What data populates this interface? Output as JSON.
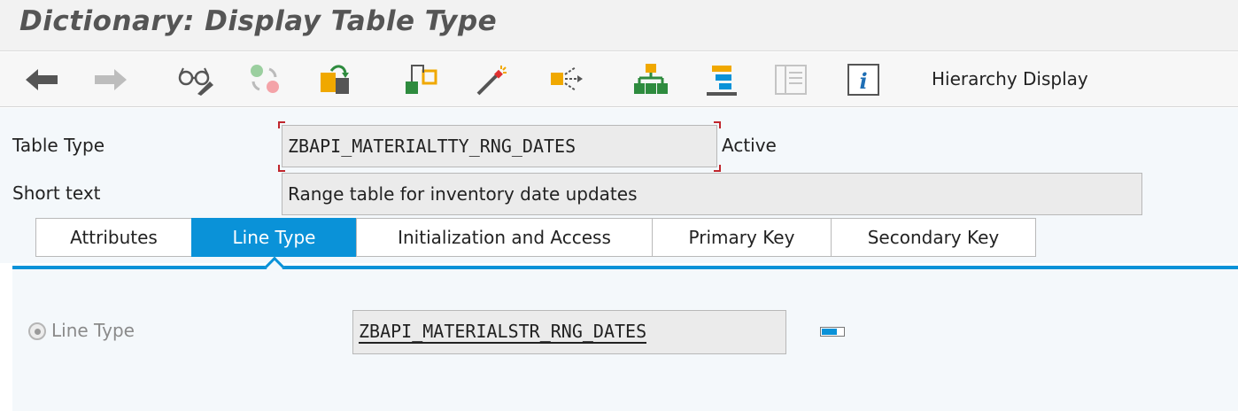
{
  "window": {
    "title": "Dictionary: Display Table Type"
  },
  "toolbar": {
    "buttons": [
      {
        "icon": "back-arrow-icon"
      },
      {
        "icon": "forward-arrow-icon"
      },
      {
        "icon": "display-change-glasses-icon"
      },
      {
        "icon": "activate-icon"
      },
      {
        "icon": "other-object-icon"
      },
      {
        "icon": "where-used-icon"
      },
      {
        "icon": "magic-wand-icon"
      },
      {
        "icon": "navigation-icon"
      },
      {
        "icon": "hierarchy-icon"
      },
      {
        "icon": "stacked-list-icon"
      },
      {
        "icon": "layout-icon"
      },
      {
        "icon": "info-icon"
      }
    ],
    "hierarchy_display_label": "Hierarchy Display"
  },
  "header": {
    "table_type_label": "Table Type",
    "table_type_value": "ZBAPI_MATERIALTTY_RNG_DATES",
    "status": "Active",
    "short_text_label": "Short text",
    "short_text_value": "Range table for inventory date updates"
  },
  "tabs": [
    {
      "label": "Attributes"
    },
    {
      "label": "Line Type"
    },
    {
      "label": "Initialization and Access"
    },
    {
      "label": "Primary Key"
    },
    {
      "label": "Secondary Key"
    }
  ],
  "active_tab": "Line Type",
  "line_type": {
    "radio_label": "Line Type",
    "value": "ZBAPI_MATERIALSTR_RNG_DATES",
    "progress_fraction": 0.7
  },
  "colors": {
    "accent": "#0a92d8",
    "focus_marker": "#c0262d",
    "hierarchy_green": "#2e8b3e",
    "hierarchy_orange": "#f5a623"
  }
}
